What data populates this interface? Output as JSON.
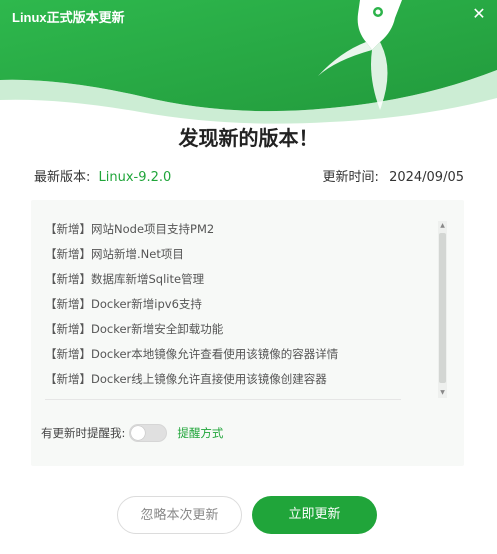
{
  "window": {
    "title": "Linux正式版本更新"
  },
  "dialog": {
    "heading": "发现新的版本！",
    "version_label": "最新版本:",
    "version_value": "Linux-9.2.0",
    "time_label": "更新时间:",
    "time_value": "2024/09/05"
  },
  "changes": [
    "【新增】网站Node项目支持PM2",
    "【新增】网站新增.Net项目",
    "【新增】数据库新增Sqlite管理",
    "【新增】Docker新增ipv6支持",
    "【新增】Docker新增安全卸载功能",
    "【新增】Docker本地镜像允许查看使用该镜像的容器详情",
    "【新增】Docker线上镜像允许直接使用该镜像创建容器"
  ],
  "reminder": {
    "label": "有更新时提醒我:",
    "enabled": false,
    "link": "提醒方式"
  },
  "buttons": {
    "ignore": "忽略本次更新",
    "update": "立即更新"
  },
  "colors": {
    "brand_green": "#20a53a",
    "header_green": "#2cb34a",
    "panel_bg": "#f7f9f7"
  },
  "icons": {
    "header_art": "rocket-icon",
    "close": "close-icon"
  }
}
